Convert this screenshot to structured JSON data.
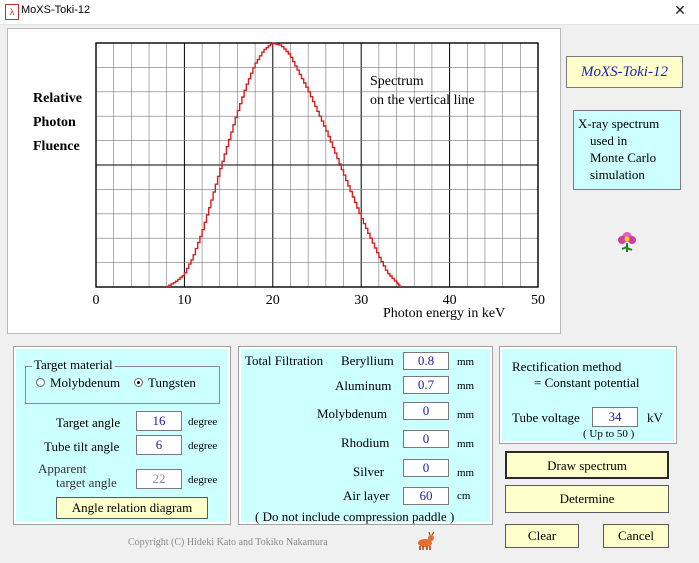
{
  "window": {
    "title": "MoXS-Toki-12",
    "close_glyph": "✕"
  },
  "chart": {
    "ylabel_lines": [
      "Relative",
      "Photon",
      "Fluence"
    ],
    "annotation_lines": [
      "Spectrum",
      "on the vertical line"
    ],
    "xlabel": "Photon energy in keV"
  },
  "chart_data": {
    "type": "line",
    "title": "",
    "xlabel": "Photon energy in keV",
    "ylabel": "Relative Photon Fluence",
    "xlim": [
      0,
      50
    ],
    "ylim": [
      0,
      1
    ],
    "xticks": [
      0,
      10,
      20,
      30,
      40,
      50
    ],
    "grid": true,
    "series": [
      {
        "color": "#d42020",
        "x": [
          8,
          9,
          10,
          11,
          12,
          13,
          14,
          15,
          16,
          17,
          18,
          19,
          20,
          21,
          22,
          23,
          24,
          25,
          26,
          27,
          28,
          29,
          30,
          31,
          32,
          33,
          34,
          34.5
        ],
        "y": [
          0,
          0.02,
          0.05,
          0.12,
          0.22,
          0.34,
          0.47,
          0.59,
          0.71,
          0.82,
          0.91,
          0.97,
          1.0,
          0.99,
          0.95,
          0.88,
          0.81,
          0.73,
          0.65,
          0.56,
          0.47,
          0.38,
          0.29,
          0.21,
          0.13,
          0.06,
          0.02,
          0
        ]
      }
    ]
  },
  "sidebar": {
    "brand": "MoXS-Toki-12",
    "info_lines": [
      "X-ray spectrum",
      "used in",
      "Monte Carlo",
      "simulation"
    ]
  },
  "target": {
    "legend": "Target material",
    "options": [
      "Molybdenum",
      "Tungsten"
    ],
    "selected": "Tungsten",
    "target_angle": {
      "label": "Target angle",
      "value": "16",
      "unit": "degree"
    },
    "tube_tilt": {
      "label": "Tube tilt angle",
      "value": "6",
      "unit": "degree"
    },
    "apparent": {
      "label_lines": [
        "Apparent",
        "target angle"
      ],
      "value": "22",
      "unit": "degree"
    },
    "diagram_button": "Angle relation diagram"
  },
  "filtration": {
    "heading": "Total Filtration",
    "rows": [
      {
        "label": "Beryllium",
        "value": "0.8",
        "unit": "mm"
      },
      {
        "label": "Aluminum",
        "value": "0.7",
        "unit": "mm"
      },
      {
        "label": "Molybdenum",
        "value": "0",
        "unit": "mm"
      },
      {
        "label": "Rhodium",
        "value": "0",
        "unit": "mm"
      },
      {
        "label": "Silver",
        "value": "0",
        "unit": "mm"
      },
      {
        "label": "Air layer",
        "value": "60",
        "unit": "cm"
      }
    ],
    "note": "( Do not include compression paddle )"
  },
  "rectification": {
    "line1": "Rectification method",
    "line2": "= Constant potential",
    "voltage_label": "Tube voltage",
    "voltage_value": "34",
    "voltage_unit": "kV",
    "voltage_hint": "( Up to 50 )"
  },
  "actions": {
    "draw": "Draw spectrum",
    "determine": "Determine",
    "clear": "Clear",
    "cancel": "Cancel"
  },
  "footer": {
    "copyright": "Copyright (C) Hideki Kato and Tokiko Nakamura"
  }
}
